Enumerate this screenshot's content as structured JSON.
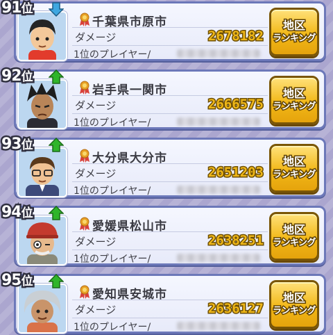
{
  "labels": {
    "damage": "ダメージ",
    "player": "1位のプレイヤー/",
    "button_line1": "地区",
    "button_line2": "ランキング"
  },
  "colors": {
    "arrow_up": "#2fb52a",
    "arrow_down": "#3fa7e0",
    "damage_text": "#efb718",
    "button": "#f2b818",
    "card_border": "#6c78b9"
  },
  "rows": [
    {
      "rank_num": "91",
      "rank_suffix": "位",
      "trend": "down",
      "trend_icon": "arrow-down-icon",
      "city": "千葉県市原市",
      "damage": "2678182",
      "avatar": "boy-short-black-hair"
    },
    {
      "rank_num": "92",
      "rank_suffix": "位",
      "trend": "up",
      "trend_icon": "arrow-up-icon",
      "city": "岩手県一関市",
      "damage": "2666575",
      "avatar": "boy-spiky-black-hair"
    },
    {
      "rank_num": "93",
      "rank_suffix": "位",
      "trend": "up",
      "trend_icon": "arrow-up-icon",
      "city": "大分県大分市",
      "damage": "2651203",
      "avatar": "man-glasses-suit"
    },
    {
      "rank_num": "94",
      "rank_suffix": "位",
      "trend": "up",
      "trend_icon": "arrow-up-icon",
      "city": "愛媛県松山市",
      "damage": "2638251",
      "avatar": "old-man-red-cap"
    },
    {
      "rank_num": "95",
      "rank_suffix": "位",
      "trend": "up",
      "trend_icon": "arrow-up-icon",
      "city": "愛知県安城市",
      "damage": "2636127",
      "avatar": "old-woman-grey-hair"
    }
  ]
}
